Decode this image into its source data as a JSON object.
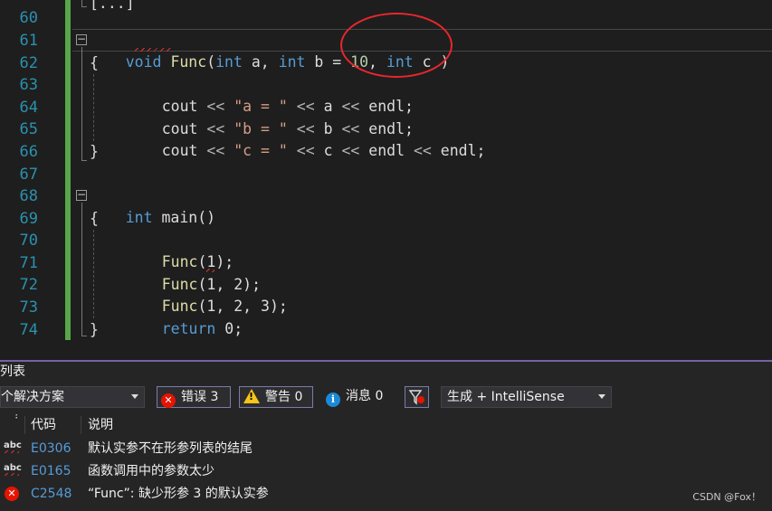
{
  "editor": {
    "line_numbers": [
      "60",
      "61",
      "62",
      "63",
      "64",
      "65",
      "66",
      "67",
      "68",
      "69",
      "70",
      "71",
      "72",
      "73",
      "74"
    ],
    "code": {
      "l60": "[...]",
      "l61": {
        "void": "void",
        "func": "Func",
        "open": "(",
        "int1": "int",
        "a": " a, ",
        "int2": "int",
        "b": " b = ",
        "ten": "10",
        "comma": ", ",
        "int3": "int",
        "c": " c ",
        "close": ")"
      },
      "l62": "{",
      "l63": {
        "cout": "cout",
        "op1": " << ",
        "str": "\"a = \"",
        "op2": " << ",
        "v": "a",
        "op3": " << ",
        "endl": "endl;"
      },
      "l64": {
        "cout": "cout",
        "op1": " << ",
        "str": "\"b = \"",
        "op2": " << ",
        "v": "b",
        "op3": " << ",
        "endl": "endl;"
      },
      "l65": {
        "cout": "cout",
        "op1": " << ",
        "str": "\"c = \"",
        "op2": " << ",
        "v": "c",
        "op3": " << ",
        "endl": "endl",
        "op4": " << ",
        "endl2": "endl;"
      },
      "l66": "}",
      "l68": {
        "int": "int",
        "main": " main()"
      },
      "l69": "{",
      "l70": {
        "fn": "Func",
        "args": "(1);"
      },
      "l71": {
        "fn": "Func",
        "args": "(1, 2);"
      },
      "l72": {
        "fn": "Func",
        "args": "(1, 2, 3);"
      },
      "l73": {
        "kw": "return",
        "rest": " 0;"
      },
      "l74": "}"
    }
  },
  "panel": {
    "title": "列表",
    "scope": "个解决方案",
    "errors_label": "错误 3",
    "warnings_label": "警告 0",
    "messages_label": "消息 0",
    "build_filter": "生成 + IntelliSense",
    "col_code": "代码",
    "col_desc": "说明",
    "rows": [
      {
        "code": "E0306",
        "desc": "默认实参不在形参列表的结尾",
        "abc": "abc"
      },
      {
        "code": "E0165",
        "desc": "函数调用中的参数太少",
        "abc": "abc"
      },
      {
        "code": "C2548",
        "desc": "“Func”: 缺少形参 3 的默认实参"
      }
    ]
  },
  "watermark": "CSDN @Fox！",
  "colors": {
    "keyword": "#569cd6",
    "function": "#dcdcaa",
    "string": "#d69d85",
    "line_number": "#2b91af",
    "change_bar": "#57a64a",
    "error": "#e51400",
    "annotation_circle": "#e8262d"
  }
}
